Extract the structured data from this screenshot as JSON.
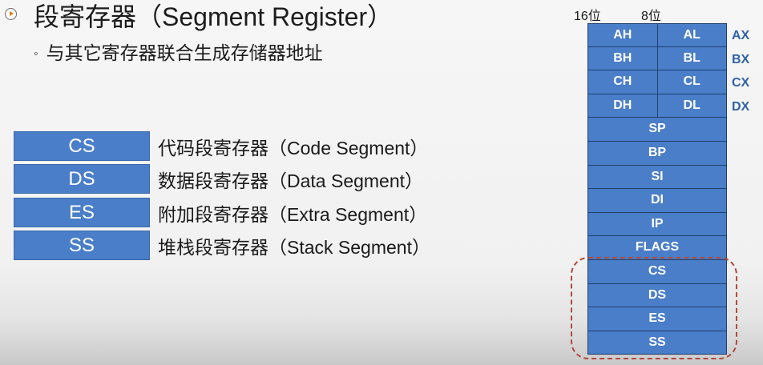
{
  "slide": {
    "title": "段寄存器（Segment Register）",
    "subtitle": "与其它寄存器联合生成存储器地址",
    "subtitle_bullet": "◦"
  },
  "segments": [
    {
      "name": "CS",
      "description": "代码段寄存器（Code Segment）"
    },
    {
      "name": "DS",
      "description": "数据段寄存器（Data Segment）"
    },
    {
      "name": "ES",
      "description": "附加段寄存器（Extra Segment）"
    },
    {
      "name": "SS",
      "description": "堆栈段寄存器（Stack Segment）"
    }
  ],
  "register_diagram": {
    "bit_label_16": "16位",
    "bit_label_8": "8位",
    "split_rows": [
      {
        "high": "AH",
        "low": "AL",
        "full": "AX"
      },
      {
        "high": "BH",
        "low": "BL",
        "full": "BX"
      },
      {
        "high": "CH",
        "low": "CL",
        "full": "CX"
      },
      {
        "high": "DH",
        "low": "DL",
        "full": "DX"
      }
    ],
    "full_rows": [
      "SP",
      "BP",
      "SI",
      "DI",
      "IP",
      "FLAGS",
      "CS",
      "DS",
      "ES",
      "SS"
    ],
    "highlight": [
      "CS",
      "DS",
      "ES",
      "SS"
    ]
  },
  "colors": {
    "register_fill": "#4a7ec8",
    "register_border": "#1f3f70",
    "side_label": "#2e63a8",
    "dashed_outline": "#b14a3c",
    "bullet_accent": "#e07a12"
  },
  "icons": {
    "title_bullet": "play-circle-icon"
  }
}
